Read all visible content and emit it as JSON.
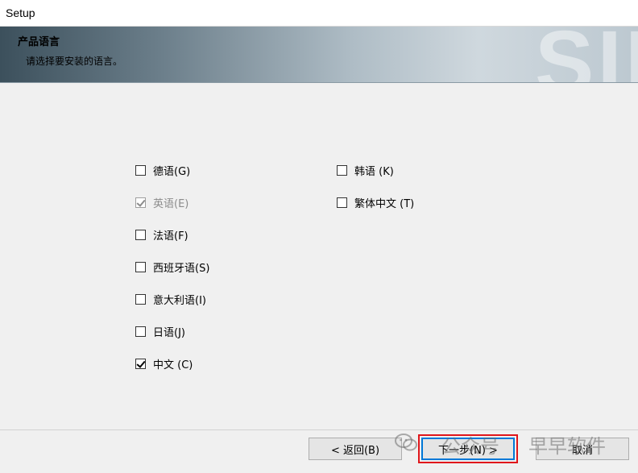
{
  "window": {
    "title": "Setup"
  },
  "header": {
    "title": "产品语言",
    "subtitle": "请选择要安装的语言。",
    "watermark_text": "SII"
  },
  "languages": [
    {
      "label": "德语(G)",
      "checked": false,
      "disabled": false
    },
    {
      "label": "英语(E)",
      "checked": true,
      "disabled": true
    },
    {
      "label": "法语(F)",
      "checked": false,
      "disabled": false
    },
    {
      "label": "西班牙语(S)",
      "checked": false,
      "disabled": false
    },
    {
      "label": "意大利语(I)",
      "checked": false,
      "disabled": false
    },
    {
      "label": "日语(J)",
      "checked": false,
      "disabled": false
    },
    {
      "label": "中文 (C)",
      "checked": true,
      "disabled": false
    },
    {
      "label": "韩语 (K)",
      "checked": false,
      "disabled": false
    },
    {
      "label": "繁体中文 (T)",
      "checked": false,
      "disabled": false
    }
  ],
  "buttons": {
    "back": "< 返回(B)",
    "next": "下一步(N) >",
    "cancel": "取消"
  },
  "overlay_watermark": {
    "text1": "公众号",
    "text2": "早早软件"
  }
}
